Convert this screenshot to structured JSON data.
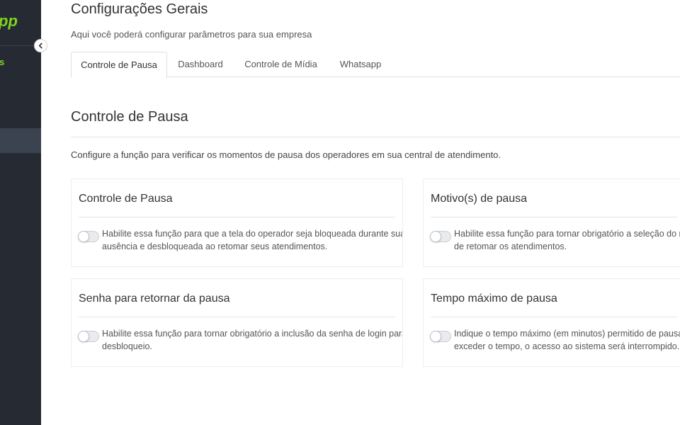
{
  "sidebar": {
    "brand": "pp",
    "nav_fragment": "s"
  },
  "page": {
    "title": "Configurações Gerais",
    "subtitle": "Aqui você poderá configurar parâmetros para sua empresa"
  },
  "tabs": [
    {
      "label": "Controle de Pausa",
      "active": true
    },
    {
      "label": "Dashboard",
      "active": false
    },
    {
      "label": "Controle de Mídia",
      "active": false
    },
    {
      "label": "Whatsapp",
      "active": false
    }
  ],
  "section": {
    "title": "Controle de Pausa",
    "description": "Configure a função para verificar os momentos de pausa dos operadores em sua central de atendimento."
  },
  "cards": [
    {
      "title": "Controle de Pausa",
      "enabled": false,
      "line1": "Habilite essa função para que a tela do operador seja bloqueada durante sua",
      "line2": "ausência e desbloqueada ao retomar seus atendimentos."
    },
    {
      "title": "Motivo(s) de pausa",
      "enabled": false,
      "line1": "Habilite essa função para tornar obrigatório a seleção do mot",
      "line2": "de retomar os atendimentos."
    },
    {
      "title": "Senha para retornar da pausa",
      "enabled": false,
      "line1": "Habilite essa função para tornar obrigatório a inclusão da senha de login para o",
      "line2": "desbloqueio."
    },
    {
      "title": "Tempo máximo de pausa",
      "enabled": false,
      "line1": "Indique o tempo máximo (em minutos) permitido de pausa ao",
      "line2": "exceder o tempo, o acesso ao sistema será interrompido."
    }
  ],
  "colors": {
    "sidebar_bg": "#262b33",
    "brand_green": "#7ed321"
  }
}
